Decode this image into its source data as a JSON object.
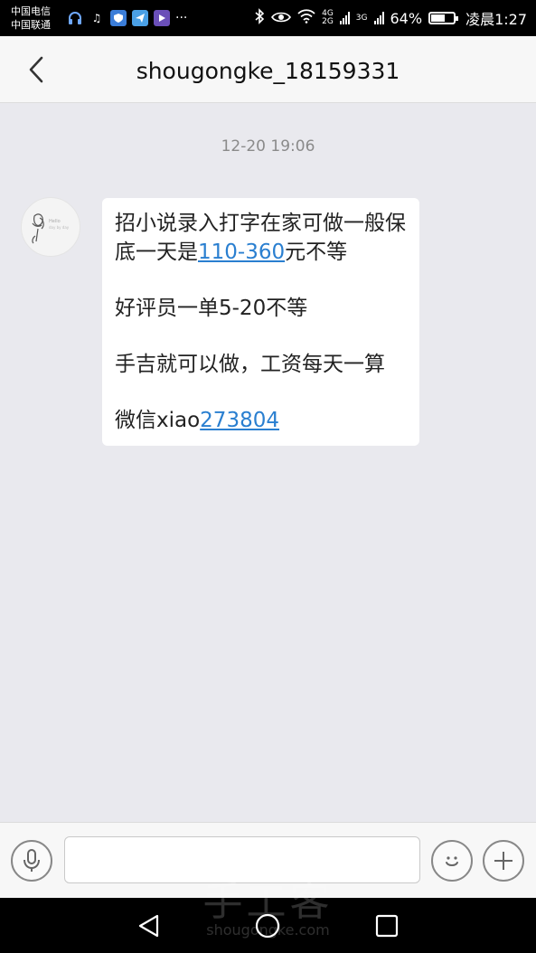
{
  "status_bar": {
    "carrier_1": "中国电信",
    "carrier_2": "中国联通",
    "network_top": "4G",
    "network_bottom": "2G",
    "network_2": "3G",
    "battery_percent": "64%",
    "battery_level": 0.64,
    "time": "凌晨1:27",
    "more_indicator": "···",
    "icons": [
      "headset-icon",
      "music-icon",
      "shield-app-icon",
      "plane-app-icon",
      "video-app-icon",
      "bluetooth-icon",
      "eye-icon",
      "wifi-icon",
      "signal-icon",
      "battery-icon"
    ]
  },
  "header": {
    "title": "shougongke_18159331"
  },
  "conversation": {
    "timestamp": "12-20 19:06",
    "message": {
      "line1_prefix": "招小说录入打字在家可做一般保底一天是",
      "line1_link": "110-360",
      "line1_suffix": "元不等",
      "line2": "好评员一单5-20不等",
      "line3": "手吉就可以做，工资每天一算",
      "line4_prefix": "微信xiao",
      "line4_link": "273804"
    }
  },
  "input_bar": {
    "text_value": "",
    "placeholder": ""
  },
  "watermark": {
    "main": "手工客",
    "sub": "shougongke.com"
  },
  "colors": {
    "link": "#2a7fd0",
    "background": "#e9e9ee",
    "bubble": "#ffffff"
  }
}
